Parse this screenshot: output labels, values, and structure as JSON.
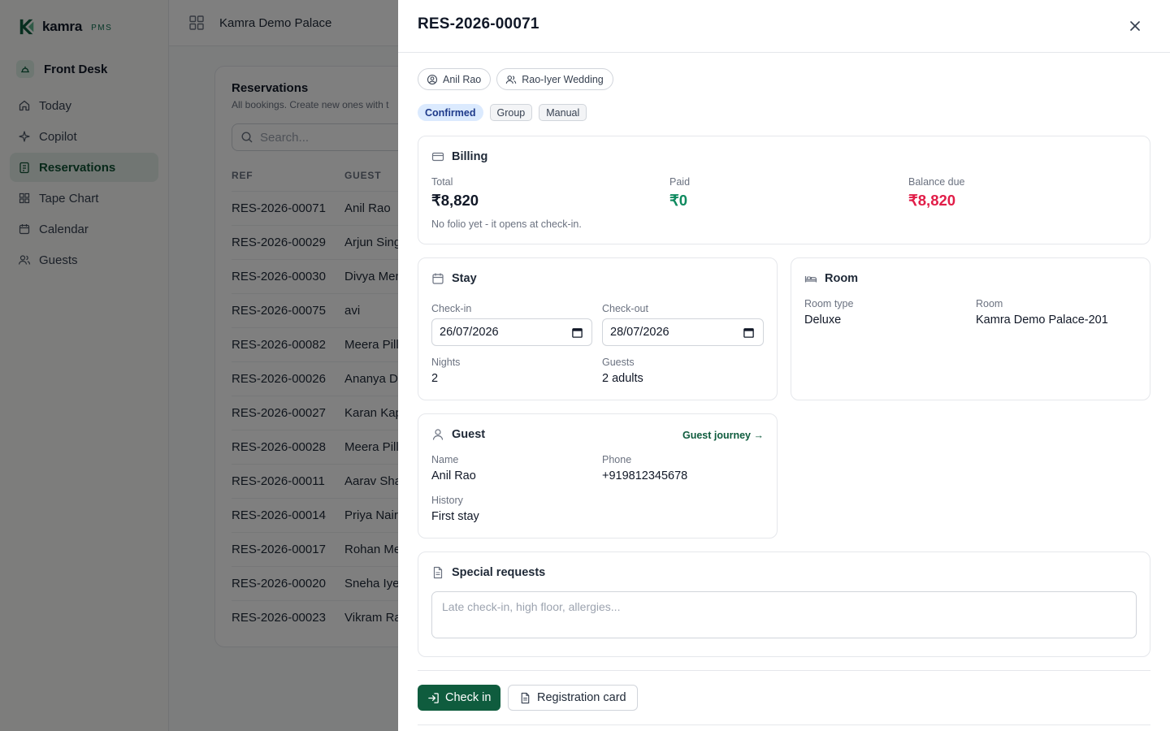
{
  "app": {
    "name": "kamra",
    "suffix": "PMS",
    "brand_color": "#0f5c3e"
  },
  "sidebar": {
    "section": "Front Desk",
    "items": [
      {
        "label": "Today",
        "icon": "home-icon"
      },
      {
        "label": "Copilot",
        "icon": "sparkle-icon"
      },
      {
        "label": "Reservations",
        "icon": "clipboard-icon",
        "active": true
      },
      {
        "label": "Tape Chart",
        "icon": "grid-icon"
      },
      {
        "label": "Calendar",
        "icon": "calendar-icon"
      },
      {
        "label": "Guests",
        "icon": "users-icon"
      }
    ]
  },
  "topbar": {
    "hotel": "Kamra Demo Palace"
  },
  "reservations": {
    "title": "Reservations",
    "subtitle": "All bookings. Create new ones with t",
    "search_placeholder": "Search...",
    "columns": [
      "REF",
      "GUEST"
    ],
    "rows": [
      [
        "RES-2026-00071",
        "Anil Rao"
      ],
      [
        "RES-2026-00029",
        "Arjun Sing"
      ],
      [
        "RES-2026-00030",
        "Divya Men"
      ],
      [
        "RES-2026-00075",
        "avi"
      ],
      [
        "RES-2026-00082",
        "Meera Pilla"
      ],
      [
        "RES-2026-00026",
        "Ananya Da"
      ],
      [
        "RES-2026-00027",
        "Karan Kap"
      ],
      [
        "RES-2026-00028",
        "Meera Pilla"
      ],
      [
        "RES-2026-00011",
        "Aarav Sha"
      ],
      [
        "RES-2026-00014",
        "Priya Nair"
      ],
      [
        "RES-2026-00017",
        "Rohan Meh"
      ],
      [
        "RES-2026-00020",
        "Sneha Iyer"
      ],
      [
        "RES-2026-00023",
        "Vikram Ra"
      ]
    ]
  },
  "drawer": {
    "title": "RES-2026-00071",
    "chips": {
      "guest": "Anil Rao",
      "group": "Rao-Iyer Wedding"
    },
    "badges": {
      "status": "Confirmed",
      "type": "Group",
      "source": "Manual"
    },
    "billing": {
      "heading": "Billing",
      "total_label": "Total",
      "total": "₹8,820",
      "paid_label": "Paid",
      "paid": "₹0",
      "balance_label": "Balance due",
      "balance": "₹8,820",
      "note": "No folio yet - it opens at check-in.",
      "paid_color": "#0f8a5f",
      "balance_color": "#e11d48"
    },
    "stay": {
      "heading": "Stay",
      "checkin_label": "Check-in",
      "checkin": "26/07/2026",
      "checkout_label": "Check-out",
      "checkout": "28/07/2026",
      "nights_label": "Nights",
      "nights": "2",
      "guests_label": "Guests",
      "guests": "2 adults"
    },
    "room": {
      "heading": "Room",
      "type_label": "Room type",
      "type": "Deluxe",
      "room_label": "Room",
      "room": "Kamra Demo Palace-201"
    },
    "guest": {
      "heading": "Guest",
      "journey_link": "Guest journey →",
      "name_label": "Name",
      "name": "Anil Rao",
      "phone_label": "Phone",
      "phone": "+919812345678",
      "history_label": "History",
      "history": "First stay"
    },
    "special": {
      "heading": "Special requests",
      "placeholder": "Late check-in, high floor, allergies..."
    },
    "actions": {
      "checkin": "Check in",
      "registration": "Registration card"
    }
  }
}
